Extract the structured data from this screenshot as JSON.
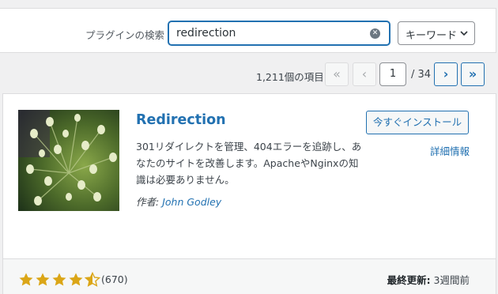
{
  "filter": {
    "search_label": "プラグインの検索",
    "search_value": "redirection",
    "type_select_value": "キーワード"
  },
  "pagination": {
    "items_count": "1,211個の項目",
    "first": "«",
    "prev": "‹",
    "current_page": "1",
    "total_pages": "/ 34",
    "next": "›",
    "last": "»"
  },
  "plugin": {
    "name": "Redirection",
    "description": "301リダイレクトを管理、404エラーを追跡し、あなたのサイトを改善します。ApacheやNginxの知識は必要ありません。",
    "author_prefix": "作者:",
    "author_name": "John Godley",
    "install_label": "今すぐインストール",
    "details_label": "詳細情報",
    "rating": 4.5,
    "rating_count": "(670)",
    "last_updated_label": "最終更新:",
    "last_updated_value": "3週間前"
  },
  "colors": {
    "accent": "#2271b1",
    "star": "#dba617"
  }
}
